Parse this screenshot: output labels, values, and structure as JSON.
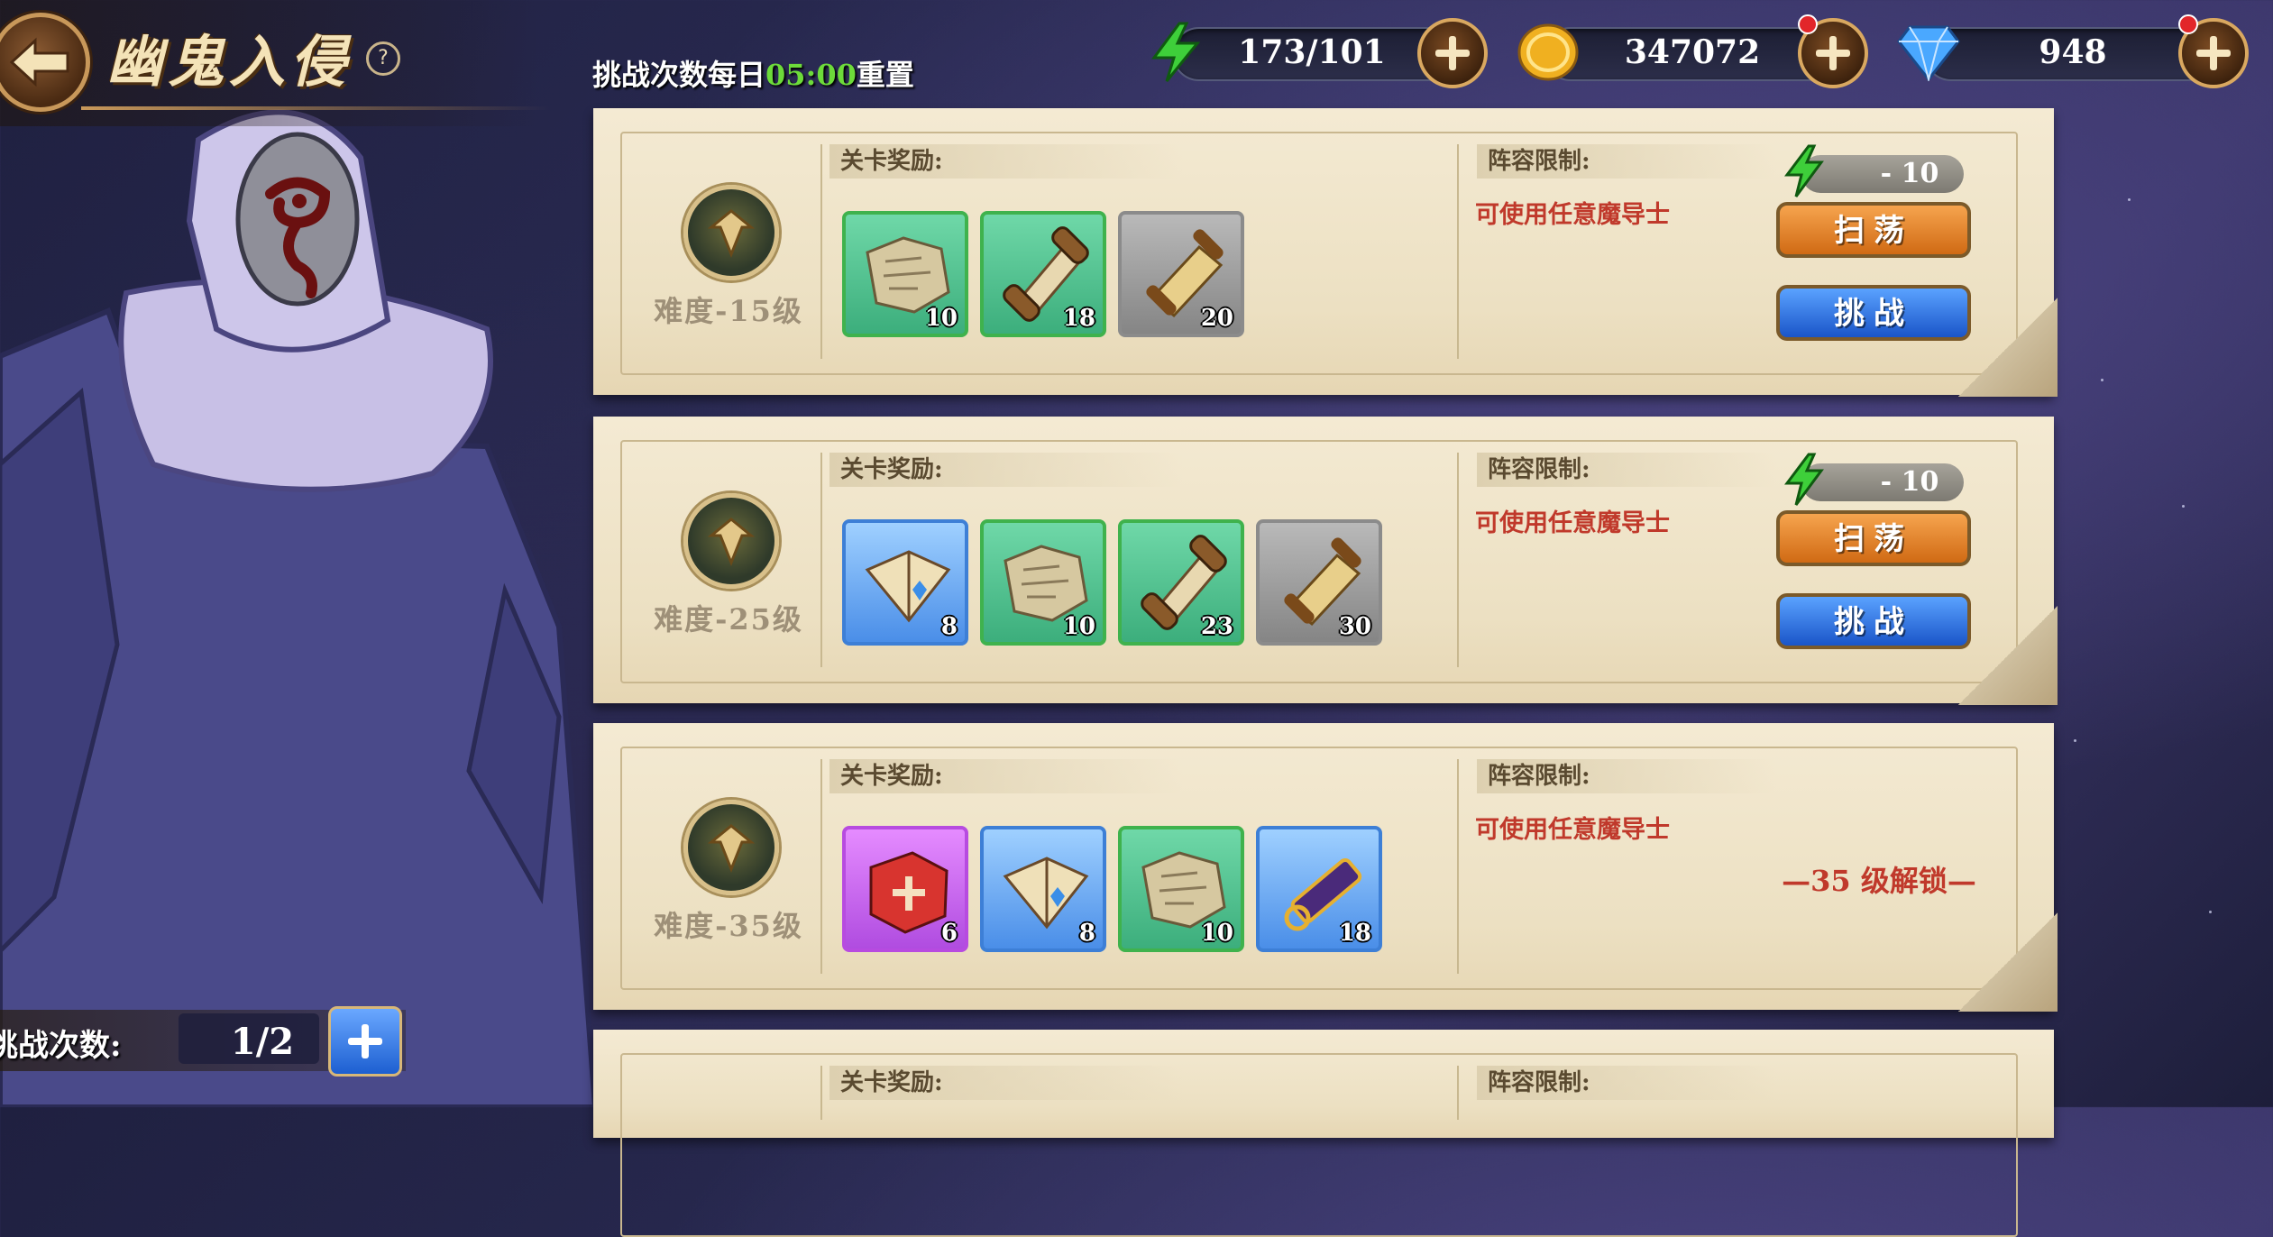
{
  "header": {
    "title": "幽鬼入侵",
    "help": "?"
  },
  "reset": {
    "prefix": "挑战次数每日",
    "time": "05:00",
    "suffix": "重置"
  },
  "currencies": {
    "energy": {
      "value": "173/101",
      "icon": "lightning-icon",
      "color": "#3ecf3a"
    },
    "gold": {
      "value": "347072",
      "icon": "gold-coin-icon",
      "color": "#f0b020"
    },
    "diamond": {
      "value": "948",
      "icon": "diamond-icon",
      "color": "#4aa8ff"
    }
  },
  "attempts": {
    "label": "挑战次数:",
    "value": "1/2"
  },
  "stages": [
    {
      "difficulty": "难度-15级",
      "reward_label": "关卡奖励:",
      "lineup_label": "阵容限制:",
      "lineup_text": "可使用任意魔导士",
      "cost": "- 10",
      "sweep": "扫荡",
      "challenge": "挑战",
      "items": [
        {
          "icon": "map-scrap-icon",
          "rarity": "green",
          "qty": "10"
        },
        {
          "icon": "scroll-icon",
          "rarity": "green",
          "qty": "18"
        },
        {
          "icon": "parchment-icon",
          "rarity": "grey",
          "qty": "20"
        }
      ]
    },
    {
      "difficulty": "难度-25级",
      "reward_label": "关卡奖励:",
      "lineup_label": "阵容限制:",
      "lineup_text": "可使用任意魔导士",
      "cost": "- 10",
      "sweep": "扫荡",
      "challenge": "挑战",
      "items": [
        {
          "icon": "book-icon",
          "rarity": "blue",
          "qty": "8"
        },
        {
          "icon": "map-scrap-icon",
          "rarity": "green",
          "qty": "10"
        },
        {
          "icon": "scroll-icon",
          "rarity": "green",
          "qty": "23"
        },
        {
          "icon": "parchment-icon",
          "rarity": "grey",
          "qty": "30"
        }
      ]
    },
    {
      "difficulty": "难度-35级",
      "reward_label": "关卡奖励:",
      "lineup_label": "阵容限制:",
      "lineup_text": "可使用任意魔导士",
      "locked": "—35 级解锁—",
      "items": [
        {
          "icon": "red-tome-icon",
          "rarity": "purple",
          "qty": "6"
        },
        {
          "icon": "book-icon",
          "rarity": "blue",
          "qty": "8"
        },
        {
          "icon": "map-scrap-icon",
          "rarity": "green",
          "qty": "10"
        },
        {
          "icon": "telescope-icon",
          "rarity": "blue",
          "qty": "18"
        }
      ]
    },
    {
      "reward_label": "关卡奖励:",
      "lineup_label": "阵容限制:"
    }
  ]
}
